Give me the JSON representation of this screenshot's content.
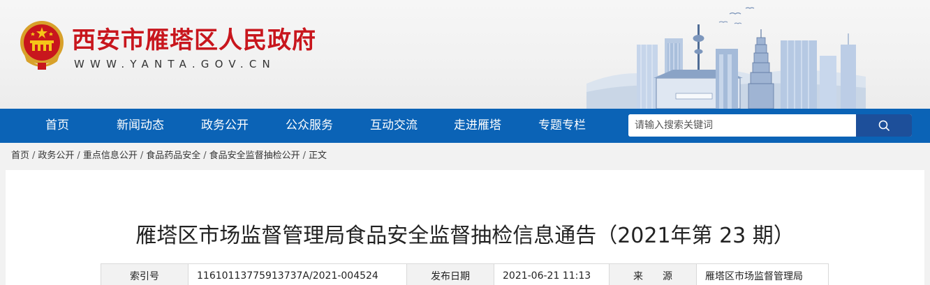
{
  "header": {
    "site_name": "西安市雁塔区人民政府",
    "site_url": "WWW.YANTA.GOV.CN"
  },
  "nav": {
    "items": [
      "首页",
      "新闻动态",
      "政务公开",
      "公众服务",
      "互动交流",
      "走进雁塔",
      "专题专栏"
    ]
  },
  "search": {
    "placeholder": "请输入搜索关键词"
  },
  "breadcrumb": [
    "首页",
    "政务公开",
    "重点信息公开",
    "食品药品安全",
    "食品安全监督抽检公开",
    "正文"
  ],
  "article": {
    "title": "雁塔区市场监督管理局食品安全监督抽检信息通告（2021年第 23 期）",
    "meta": {
      "index_label": "索引号",
      "index_value": "11610113775913737A/2021-004524",
      "date_label": "发布日期",
      "date_value": "2021-06-21 11:13",
      "source_label": "来　　源",
      "source_value": "雁塔区市场监督管理局"
    }
  },
  "colors": {
    "brand_red": "#c8161d",
    "nav_blue": "#0b63b6",
    "search_button": "#1d4f9a"
  }
}
